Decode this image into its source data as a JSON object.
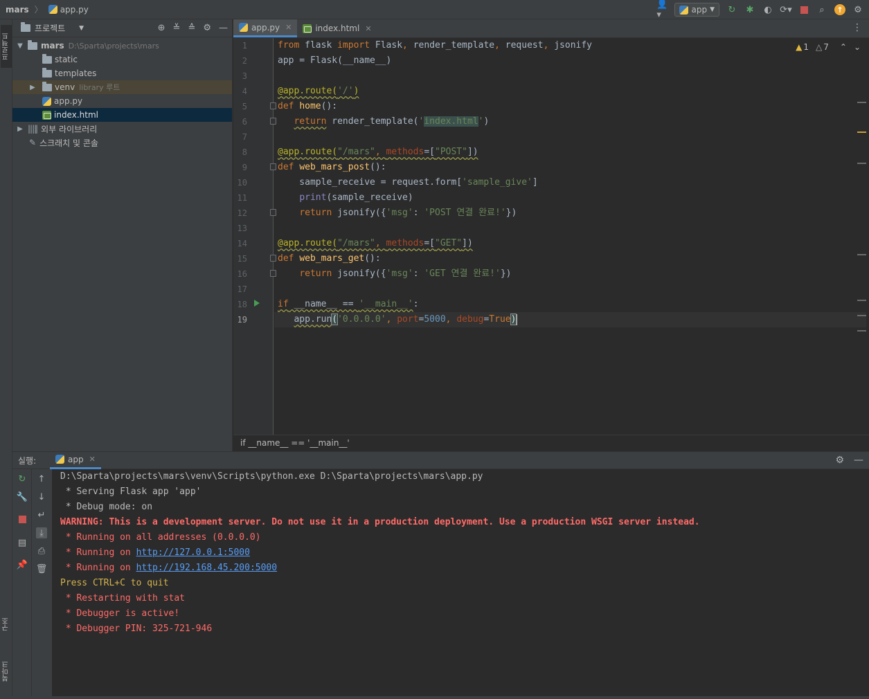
{
  "navbar": {
    "project_name": "mars",
    "current_file": "app.py",
    "run_config": "app"
  },
  "left_stripe": {
    "project_tab": "프로젝트",
    "structure_tab": "구조",
    "bookmarks_tab": "북마크"
  },
  "project_panel": {
    "title": "프로젝트",
    "tree": [
      {
        "label": "mars",
        "hint": "D:\\Sparta\\projects\\mars",
        "type": "folder",
        "expanded": true
      },
      {
        "label": "static",
        "type": "folder"
      },
      {
        "label": "templates",
        "type": "folder"
      },
      {
        "label": "venv",
        "hint": "library 루트",
        "type": "folder",
        "expanded": false
      },
      {
        "label": "app.py",
        "type": "python"
      },
      {
        "label": "index.html",
        "type": "html"
      },
      {
        "label": "외부 라이브러리",
        "type": "library"
      },
      {
        "label": "스크래치 및 콘솔",
        "type": "scratch"
      }
    ]
  },
  "editor": {
    "tabs": [
      {
        "label": "app.py",
        "active": true
      },
      {
        "label": "index.html",
        "active": false
      }
    ],
    "inspection": {
      "errors": "1",
      "warnings": "7"
    },
    "line_numbers": [
      "1",
      "2",
      "3",
      "4",
      "5",
      "6",
      "7",
      "8",
      "9",
      "10",
      "11",
      "12",
      "13",
      "14",
      "15",
      "16",
      "17",
      "18",
      "19"
    ],
    "current_line": "19",
    "breadcrumb": "if __name__ == '__main__'"
  },
  "run_panel": {
    "title": "실행:",
    "tab": "app",
    "console": [
      "D:\\Sparta\\projects\\mars\\venv\\Scripts\\python.exe D:\\Sparta\\projects\\mars\\app.py",
      " * Serving Flask app 'app'",
      " * Debug mode: on",
      "WARNING: This is a development server. Do not use it in a production deployment. Use a production WSGI server instead.",
      " * Running on all addresses (0.0.0.0)",
      " * Running on ",
      "http://127.0.0.1:5000",
      " * Running on ",
      "http://192.168.45.200:5000",
      "Press CTRL+C to quit",
      " * Restarting with stat",
      " * Debugger is active!",
      " * Debugger PIN: 325-721-946"
    ]
  },
  "colors": {
    "keyword": "#cc7832",
    "string": "#6a8759",
    "decorator": "#bbb529",
    "function": "#ffc66d",
    "number": "#6897bb",
    "console_error": "#ff6b68",
    "console_link": "#589df6",
    "accent": "#4a88c7"
  }
}
